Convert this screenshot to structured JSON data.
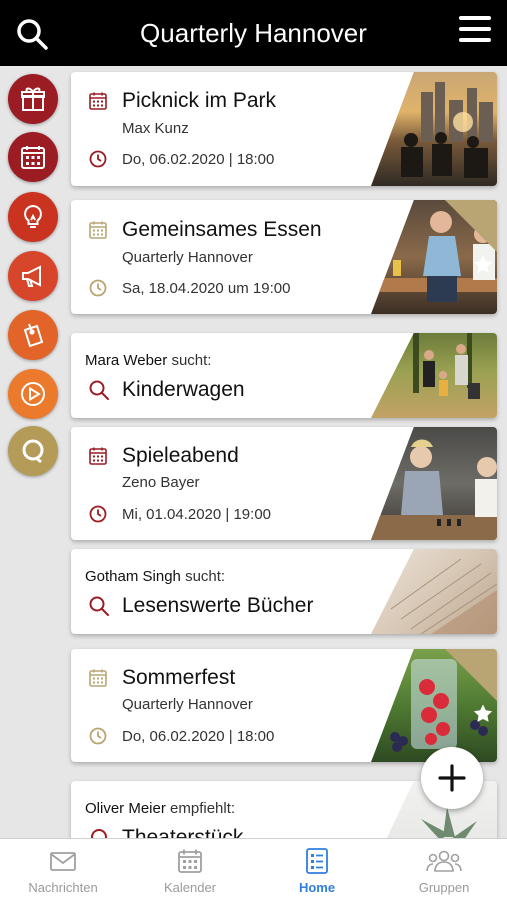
{
  "header": {
    "title": "Quarterly Hannover"
  },
  "rail": {
    "items": [
      {
        "name": "gift-icon",
        "color": "#9b1c23"
      },
      {
        "name": "calendar-icon",
        "color": "#9b1c23"
      },
      {
        "name": "lightbulb-icon",
        "color": "#c9331f"
      },
      {
        "name": "megaphone-icon",
        "color": "#d7462a"
      },
      {
        "name": "tag-icon",
        "color": "#e26428"
      },
      {
        "name": "play-icon",
        "color": "#ec7a2c"
      },
      {
        "name": "quarterly-logo-icon",
        "color": "#b59b58"
      }
    ]
  },
  "cards": [
    {
      "title": "Picknick im Park",
      "sub": "Max Kunz",
      "date": "Do, 06.02.2020 | 18:00",
      "featured": false
    },
    {
      "title": "Gemeinsames Essen",
      "sub": "Quarterly Hannover",
      "date": "Sa, 18.04.2020 um 19:00",
      "featured": true
    },
    {
      "who": "Mara Weber",
      "verb": "sucht:",
      "title": "Kinderwagen"
    },
    {
      "title": "Spieleabend",
      "sub": "Zeno Bayer",
      "date": "Mi, 01.04.2020 | 19:00",
      "featured": false
    },
    {
      "who": "Gotham Singh",
      "verb": "sucht:",
      "title": "Lesenswerte Bücher"
    },
    {
      "title": "Sommerfest",
      "sub": "Quarterly Hannover",
      "date": "Do, 06.02.2020 | 18:00",
      "featured": true
    },
    {
      "who": "Oliver Meier",
      "verb": "empfiehlt:",
      "title": "Theaterstück"
    }
  ],
  "nav": {
    "items": [
      {
        "label": "Nachrichten",
        "icon": "mail-icon"
      },
      {
        "label": "Kalender",
        "icon": "calendar-icon"
      },
      {
        "label": "Home",
        "icon": "list-icon",
        "active": true
      },
      {
        "label": "Gruppen",
        "icon": "group-icon"
      }
    ]
  },
  "colors": {
    "accent_red": "#9b1c23",
    "accent_gold": "#b9a574",
    "active_blue": "#2f7fe0"
  }
}
